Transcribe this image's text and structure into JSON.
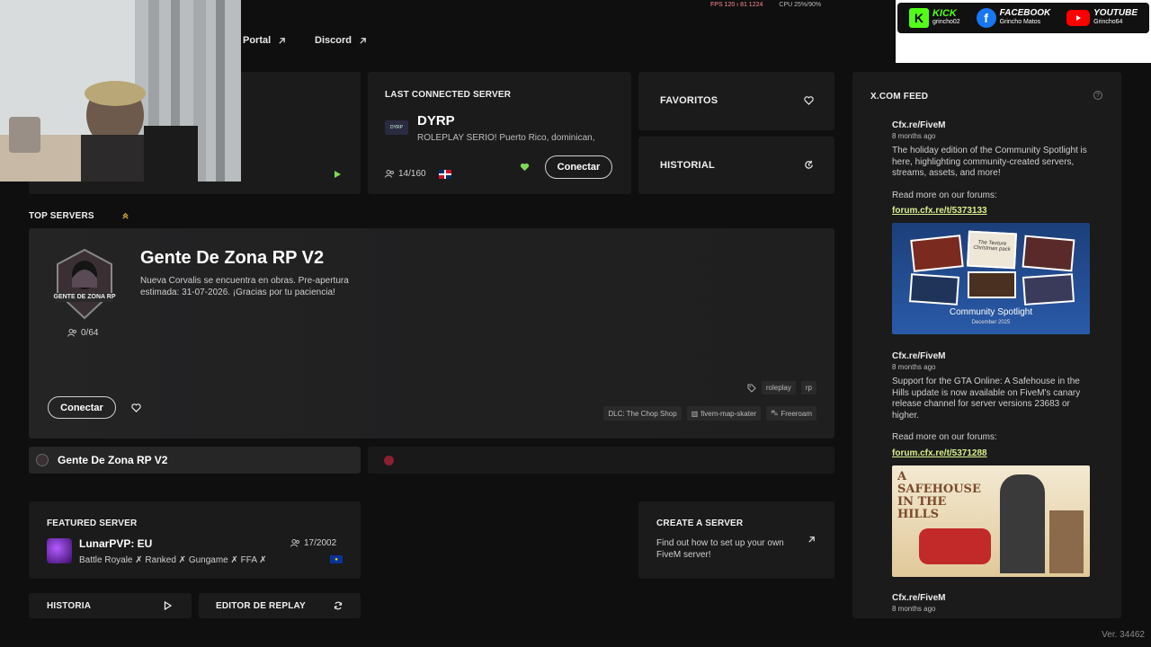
{
  "top_links": {
    "portal": "Portal",
    "discord": "Discord"
  },
  "overlay": {
    "perf": "FPS 120 ı 81 1224",
    "cpu": "CPU 25%/90%",
    "kick": {
      "name": "KICK",
      "handle": "grincho02"
    },
    "facebook": {
      "name": "FACEBOOK",
      "handle": "Grincho Matos"
    },
    "youtube": {
      "name": "YOUTUBE",
      "handle": "Grincho64"
    }
  },
  "last_connected": {
    "heading": "LAST CONNECTED SERVER",
    "name": "DYRP",
    "description": "ROLEPLAY SERIO! Puerto Rico, dominican,",
    "players": "14/160",
    "connect_label": "Conectar"
  },
  "favoritos": {
    "label": "FAVORITOS"
  },
  "historial": {
    "label": "HISTORIAL"
  },
  "top_servers": {
    "heading": "TOP SERVERS",
    "featured": {
      "name": "Gente De Zona RP V2",
      "logo_text": "GENTE DE ZONA RP",
      "description": "Nueva Corvalis se encuentra en obras. Pre-apertura estimada: 31-07-2026. ¡Gracias por tu paciencia!",
      "players": "0/64",
      "connect_label": "Conectar",
      "tags": [
        "roleplay",
        "rp"
      ],
      "resources": [
        "DLC: The Chop Shop",
        "fivem-map-skater",
        "Freeroam"
      ]
    },
    "selected_tab": "Gente De Zona RP V2"
  },
  "featured_server": {
    "heading": "FEATURED SERVER",
    "name": "LunarPVP: EU",
    "tags_line": "Battle Royale ✗ Ranked ✗ Gungame ✗ FFA ✗",
    "players": "17/2002"
  },
  "create_server": {
    "heading": "CREATE A SERVER",
    "text": "Find out how to set up your own FiveM server!"
  },
  "bottom_buttons": {
    "historia": "HISTORIA",
    "editor": "EDITOR DE REPLAY"
  },
  "feed": {
    "heading": "X.COM FEED",
    "posts": [
      {
        "author": "Cfx.re/FiveM",
        "time": "8 months ago",
        "body": "The holiday edition of the Community Spotlight is here, highlighting community-created servers, streams, assets, and more!",
        "read_more": "Read more on our forums:",
        "link": "forum.cfx.re/t/5373133",
        "image_caption": "Community Spotlight",
        "image_sub": "December 2025",
        "image_title": "The Texture Christmas pack"
      },
      {
        "author": "Cfx.re/FiveM",
        "time": "8 months ago",
        "body": "Support for the GTA Online: A Safehouse in the Hills update is now available on FiveM's canary release channel for server versions 23683 or higher.",
        "read_more": "Read more on our forums:",
        "link": "forum.cfx.re/t/5371288",
        "image_caption": "A SAFEHOUSE IN THE HILLS"
      },
      {
        "author": "Cfx.re/FiveM",
        "time": "8 months ago"
      }
    ]
  },
  "version": "Ver. 34462",
  "colors": {
    "accent_green": "#7ed957",
    "link": "#d8f08a",
    "panel": "#1b1b1c",
    "bg": "#0f0f10"
  }
}
